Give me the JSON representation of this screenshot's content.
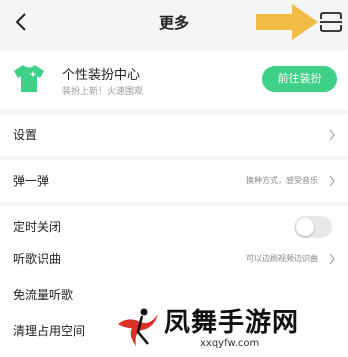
{
  "header": {
    "title": "更多"
  },
  "promo": {
    "title": "个性装扮中心",
    "subtitle": "装扮上新！火速围观",
    "button": "前往装扮"
  },
  "rows": {
    "settings": {
      "label": "设置"
    },
    "danmu": {
      "label": "弹一弹",
      "hint": "换种方式，感受音乐"
    },
    "timer": {
      "label": "定时关闭",
      "toggle_on": false
    },
    "recognize": {
      "label": "听歌识曲",
      "hint": "可以边刷视频边识曲"
    },
    "free_data": {
      "label": "免流量听歌"
    },
    "clear": {
      "label": "清理占用空间"
    }
  },
  "watermark": {
    "text": "凤舞手游网",
    "url": "xxqyfw.com"
  },
  "colors": {
    "accent": "#3dd086",
    "arrow": "#f0bc45",
    "background": "#f4f5f7"
  },
  "icons": {
    "back": "back-arrow-icon",
    "scan": "scan-icon",
    "shirt": "tshirt-icon",
    "chevron": "chevron-right-icon"
  }
}
